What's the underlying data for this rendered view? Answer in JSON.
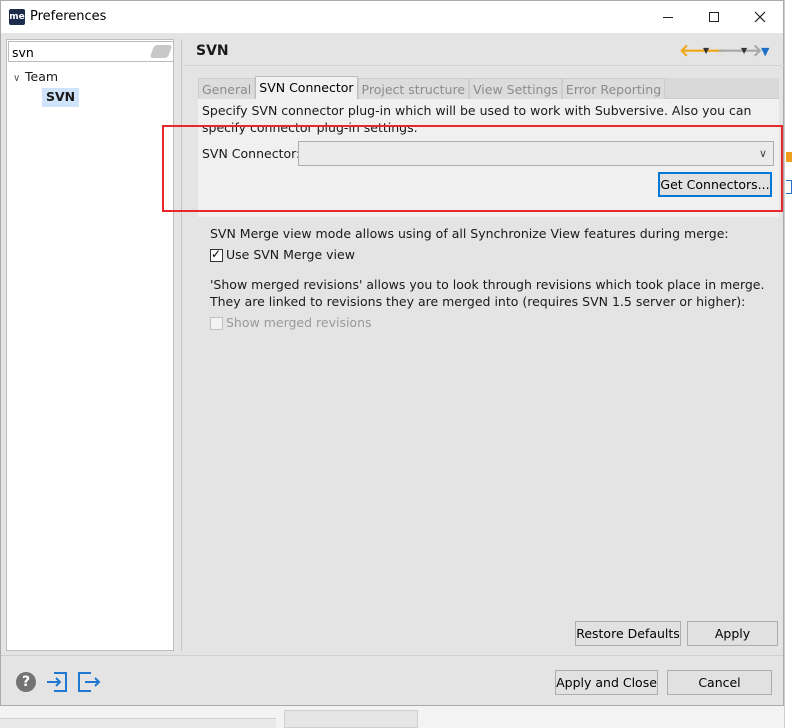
{
  "window": {
    "title": "Preferences",
    "app_icon_text": "me"
  },
  "sidebar": {
    "filter_value": "svn",
    "tree": {
      "team_label": "Team",
      "svn_label": "SVN"
    }
  },
  "page": {
    "title": "SVN",
    "tabs": [
      {
        "label": "General"
      },
      {
        "label": "SVN Connector"
      },
      {
        "label": "Project structure"
      },
      {
        "label": "View Settings"
      },
      {
        "label": "Error Reporting"
      }
    ],
    "description": "Specify SVN connector plug-in which will be used to work with Subversive. Also you can specify connector plug-in settings.",
    "connector_label": "SVN Connector:",
    "connector_value": "",
    "get_connectors_label": "Get Connectors...",
    "merge_text": "SVN Merge view mode allows using of all Synchronize View features during merge:",
    "use_merge_label": "Use SVN Merge view",
    "revisions_text": "'Show merged revisions' allows you to look through revisions which took place in merge. They are linked to revisions they are merged into (requires SVN 1.5 server or higher):",
    "show_revisions_label": "Show merged revisions",
    "restore_defaults_label": "Restore Defaults",
    "apply_label": "Apply"
  },
  "footer": {
    "help_glyph": "?",
    "apply_close_label": "Apply and Close",
    "cancel_label": "Cancel"
  },
  "colors": {
    "highlight_box": "#e8282a",
    "back_arrow": "#f0a818",
    "selection": "#cfe3fa",
    "icon_blue": "#1f78d1"
  }
}
